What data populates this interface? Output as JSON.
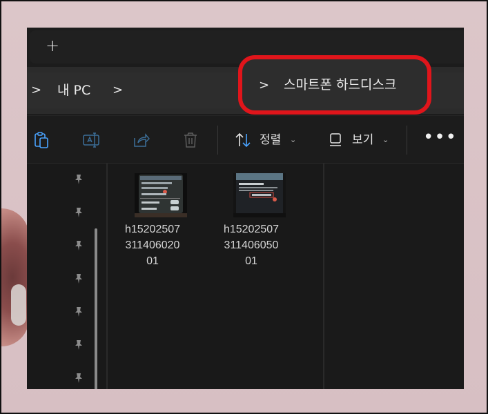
{
  "tabbar": {
    "new_tab_label": "+"
  },
  "address": {
    "crumbs": [
      {
        "sep": ">",
        "label": "내 PC"
      },
      {
        "sep": ">",
        "label": ""
      },
      {
        "sep": ">",
        "label": "스마트폰 하드디스크"
      }
    ]
  },
  "toolbar": {
    "sort_label": "정렬",
    "view_label": "보기",
    "more_label": "•••",
    "caret": "⌄"
  },
  "files": [
    {
      "name": "h1520250731140602001",
      "lines": [
        "h15202507",
        "311406020",
        "01"
      ]
    },
    {
      "name": "h1520250731140605001",
      "lines": [
        "h15202507",
        "311406050",
        "01"
      ]
    }
  ],
  "colors": {
    "highlight_ring": "#e0151b",
    "accent_blue": "#4aa3ff"
  },
  "icons": [
    "paste-icon",
    "rename-icon",
    "share-icon",
    "delete-icon",
    "sort-icon",
    "view-icon",
    "pin-icon"
  ]
}
